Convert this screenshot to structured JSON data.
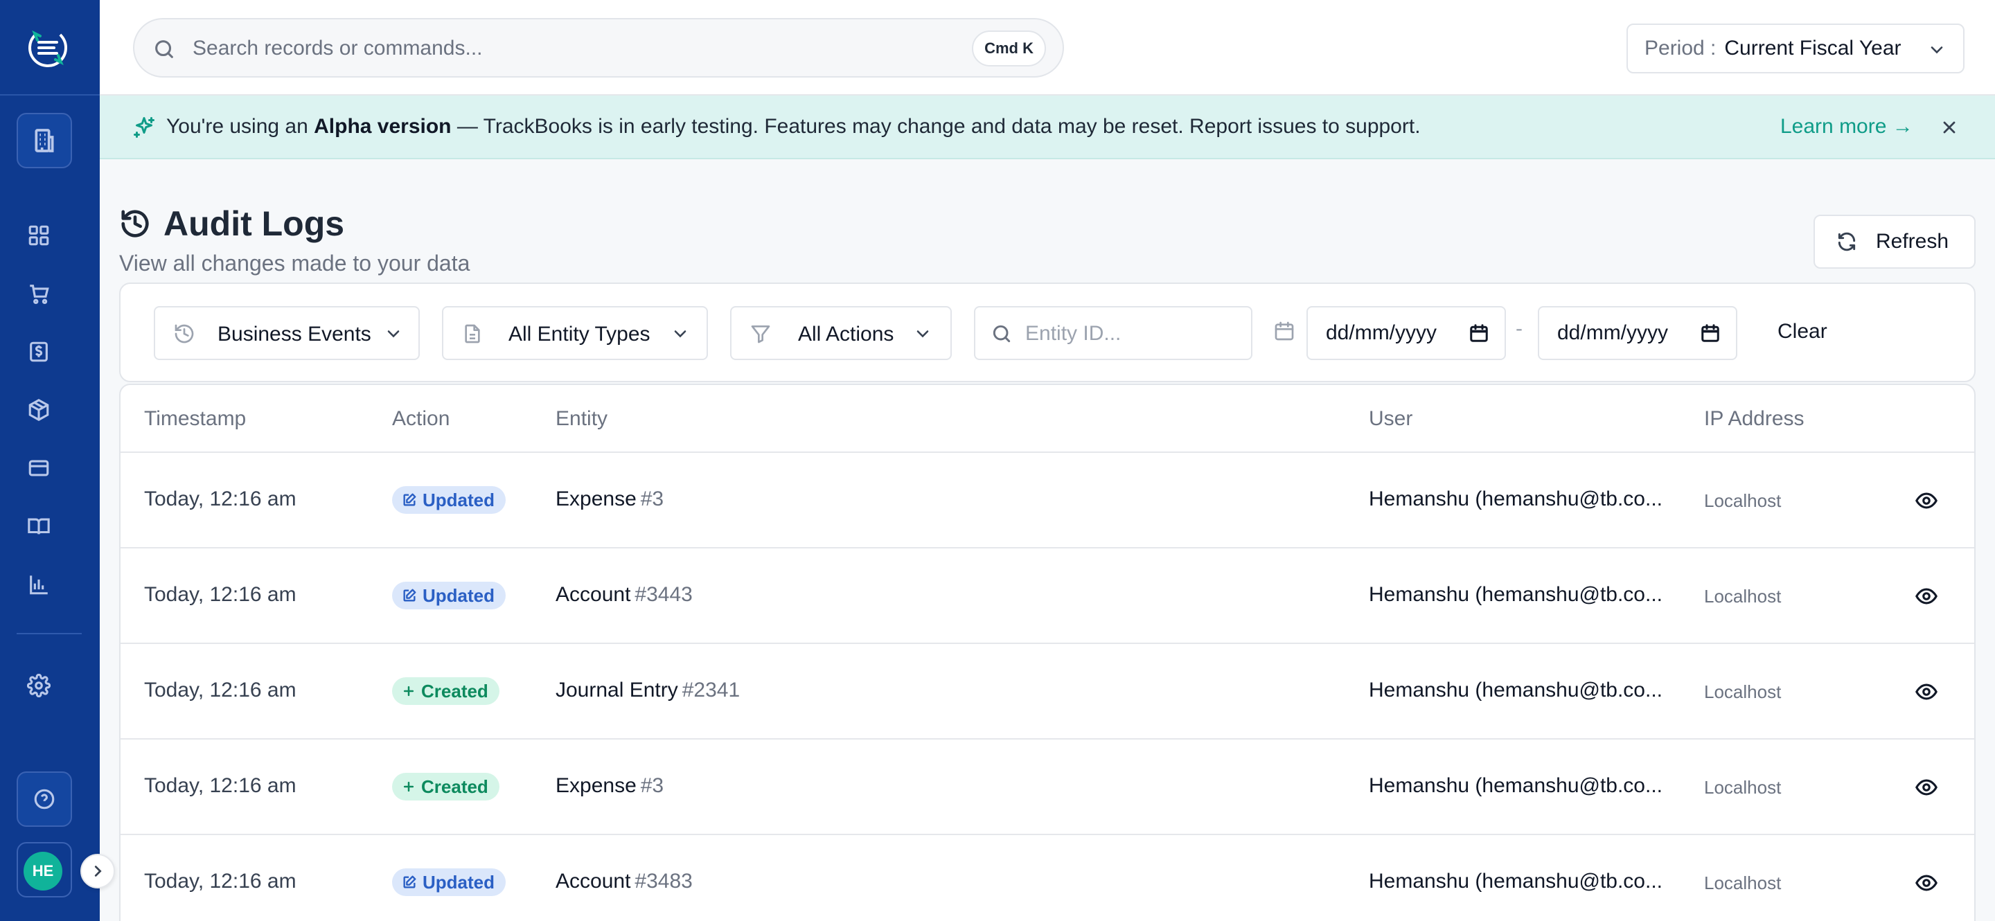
{
  "app": {
    "brand": "TrackBooks"
  },
  "user": {
    "initials": "HE"
  },
  "search": {
    "placeholder": "Search records or commands...",
    "shortcut": "Cmd K"
  },
  "period": {
    "label": "Period :",
    "value": "Current Fiscal Year"
  },
  "banner": {
    "prefix": "You're using an ",
    "highlight": "Alpha version",
    "suffix": " — TrackBooks is in early testing. Features may change and data may be reset. Report issues to support.",
    "link": "Learn more →"
  },
  "page": {
    "title": "Audit Logs",
    "subtitle": "View all changes made to your data",
    "refresh_label": "Refresh"
  },
  "filters": {
    "event_type": "Business Events",
    "entity_type": "All Entity Types",
    "action": "All Actions",
    "entity_id_placeholder": "Entity ID...",
    "date_from": "dd/mm/yyyy",
    "date_separator": "-",
    "date_to": "dd/mm/yyyy",
    "clear_label": "Clear"
  },
  "table": {
    "headers": [
      "Timestamp",
      "Action",
      "Entity",
      "User",
      "IP Address"
    ],
    "rows": [
      {
        "timestamp": "Today, 12:16 am",
        "action": "Updated",
        "entity": "Expense",
        "entity_id": "#3",
        "user": "Hemanshu (hemanshu@tb.co...",
        "ip": "Localhost"
      },
      {
        "timestamp": "Today, 12:16 am",
        "action": "Updated",
        "entity": "Account",
        "entity_id": "#3443",
        "user": "Hemanshu (hemanshu@tb.co...",
        "ip": "Localhost"
      },
      {
        "timestamp": "Today, 12:16 am",
        "action": "Created",
        "entity": "Journal Entry",
        "entity_id": "#2341",
        "user": "Hemanshu (hemanshu@tb.co...",
        "ip": "Localhost"
      },
      {
        "timestamp": "Today, 12:16 am",
        "action": "Created",
        "entity": "Expense",
        "entity_id": "#3",
        "user": "Hemanshu (hemanshu@tb.co...",
        "ip": "Localhost"
      },
      {
        "timestamp": "Today, 12:16 am",
        "action": "Updated",
        "entity": "Account",
        "entity_id": "#3483",
        "user": "Hemanshu (hemanshu@tb.co...",
        "ip": "Localhost"
      }
    ]
  },
  "colors": {
    "sidebar": "#0e3a8f",
    "accent": "#10b39a",
    "banner": "#dcf3f1",
    "updated_badge": "#dbe7fb",
    "created_badge": "#d5f5e8"
  }
}
